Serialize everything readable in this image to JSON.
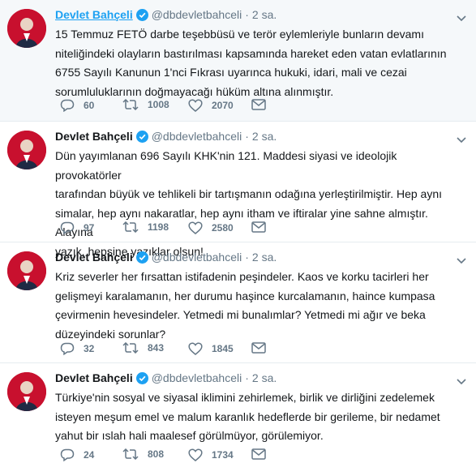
{
  "tweets": [
    {
      "name": "Devlet Bahçeli",
      "handle": "@dbdevletbahceli",
      "time": "2 sa.",
      "text": "15 Temmuz FETÖ darbe teşebbüsü ve terör eylemleriyle bunların devamı\nniteliğindeki olayların bastırılması kapsamında hareket eden vatan evlatlarının\n6755 Sayılı Kanunun 1'nci Fıkrası uyarınca hukuki, idari, mali ve cezai\nsorumluluklarının doğmayacağı hüküm altına alınmıştır.",
      "replies": "60",
      "retweets": "1008",
      "likes": "2070"
    },
    {
      "name": "Devlet Bahçeli",
      "handle": "@dbdevletbahceli",
      "time": "2 sa.",
      "text": "Dün yayımlanan 696 Sayılı KHK'nin 121. Maddesi siyasi ve ideolojik provokatörler\ntarafından büyük ve tehlikeli bir tartışmanın odağına yerleştirilmiştir. Hep aynı\nsimalar, hep aynı nakaratlar, hep aynı itham ve iftiralar yine sahne almıştır. Alayına\nyazık, hepsine yazıklar olsun!",
      "replies": "97",
      "retweets": "1198",
      "likes": "2580"
    },
    {
      "name": "Devlet Bahçeli",
      "handle": "@dbdevletbahceli",
      "time": "2 sa.",
      "text": "Kriz severler her fırsattan istifadenin peşindeler. Kaos ve korku tacirleri her\ngelişmeyi karalamanın, her durumu haşince kurcalamanın, haince kumpasa\nçevirmenin hevesindeler. Yetmedi mi bunalımlar? Yetmedi mi ağır ve beka\ndüzeyindeki sorunlar?",
      "replies": "32",
      "retweets": "843",
      "likes": "1845"
    },
    {
      "name": "Devlet Bahçeli",
      "handle": "@dbdevletbahceli",
      "time": "2 sa.",
      "text": "Türkiye'nin sosyal ve siyasal iklimini zehirlemek, birlik ve dirliğini zedelemek\nisteyen meşum emel ve malum karanlık hedeflerde bir gerileme, bir nedamet\nyahut bir ıslah hali maalesef görülmüyor, görülemiyor.",
      "replies": "24",
      "retweets": "808",
      "likes": "1734"
    }
  ],
  "icons": {
    "verified": "verified-badge-icon",
    "chevron": "chevron-down-icon",
    "reply": "reply-icon",
    "retweet": "retweet-icon",
    "like": "heart-icon",
    "dm": "direct-message-icon"
  },
  "colors": {
    "name": "#14171a",
    "name_hover_link": "#1da1f2",
    "muted": "#657786",
    "verified": "#1da1f2",
    "avatar_bg": "#c8102e",
    "highlight_row": "#f5f8fa"
  }
}
